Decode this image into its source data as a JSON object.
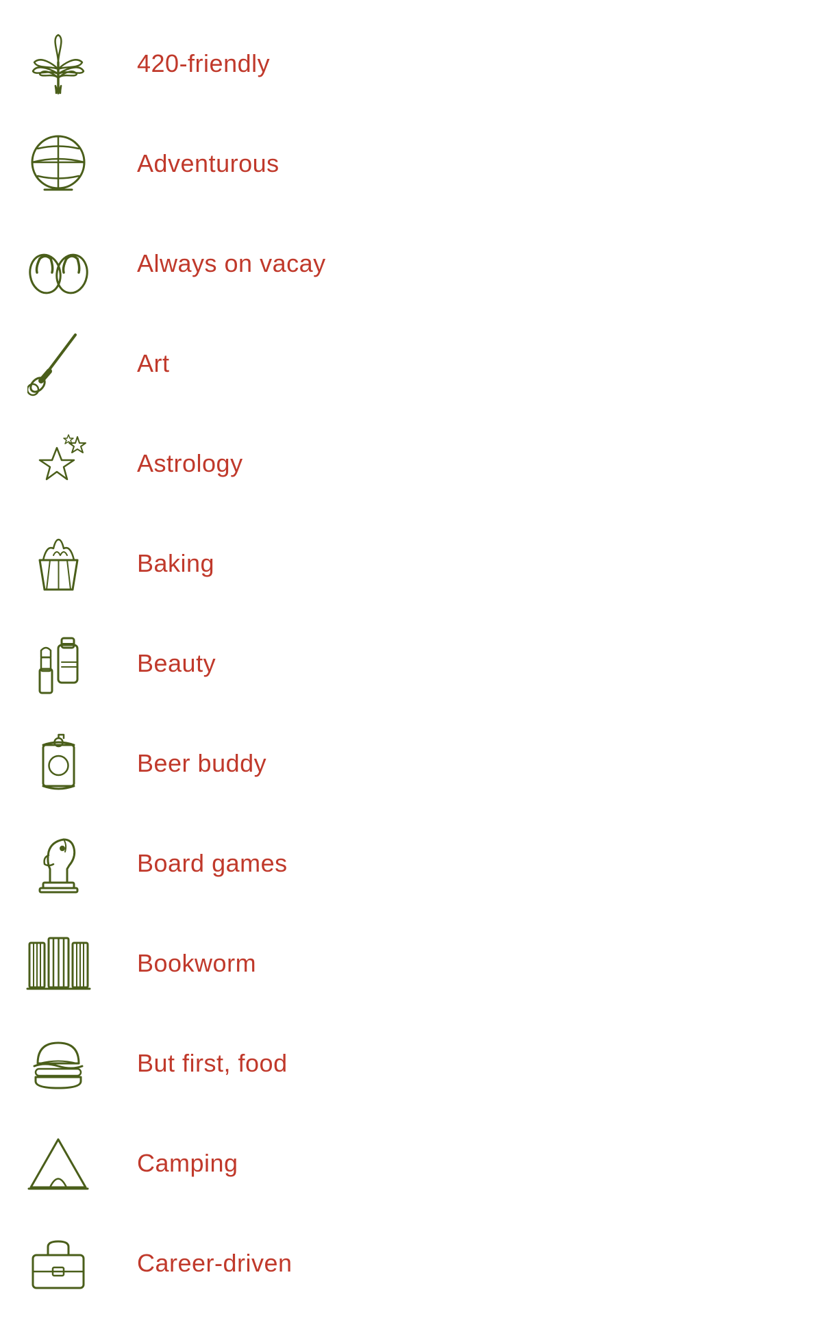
{
  "items": [
    {
      "id": "420-friendly",
      "label": "420-friendly",
      "icon": "cannabis"
    },
    {
      "id": "adventurous",
      "label": "Adventurous",
      "icon": "globe"
    },
    {
      "id": "always-on-vacay",
      "label": "Always on vacay",
      "icon": "flip-flops"
    },
    {
      "id": "art",
      "label": "Art",
      "icon": "paintbrush"
    },
    {
      "id": "astrology",
      "label": "Astrology",
      "icon": "stars"
    },
    {
      "id": "baking",
      "label": "Baking",
      "icon": "cupcake"
    },
    {
      "id": "beauty",
      "label": "Beauty",
      "icon": "beauty"
    },
    {
      "id": "beer-buddy",
      "label": "Beer buddy",
      "icon": "beer"
    },
    {
      "id": "board-games",
      "label": "Board games",
      "icon": "chess"
    },
    {
      "id": "bookworm",
      "label": "Bookworm",
      "icon": "books"
    },
    {
      "id": "but-first-food",
      "label": "But first, food",
      "icon": "burger"
    },
    {
      "id": "camping",
      "label": "Camping",
      "icon": "camping"
    },
    {
      "id": "career-driven",
      "label": "Career-driven",
      "icon": "briefcase"
    }
  ]
}
